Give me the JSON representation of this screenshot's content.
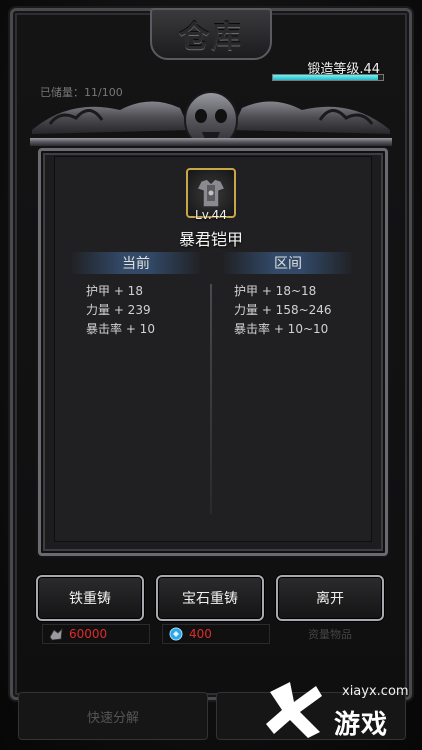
{
  "header": {
    "title": "仓库",
    "forge_level": "锻造等级.44",
    "forge_progress": 0.95,
    "capacity_text": "已储量：11/100"
  },
  "item": {
    "level": "Lv.44",
    "name": "暴君铠甲",
    "icon": "armor-icon",
    "rarity_color": "#c9a64a"
  },
  "columns": {
    "current_label": "当前",
    "range_label": "区间"
  },
  "current_stats": [
    "护甲 + 18",
    "力量 + 239",
    "暴击率 + 10"
  ],
  "range_stats": [
    "护甲 + 18~18",
    "力量 + 158~246",
    "暴击率 + 10~10"
  ],
  "actions": {
    "iron_recast": "铁重铸",
    "gem_recast": "宝石重铸",
    "leave": "离开",
    "under_leave": "资量物品"
  },
  "costs": {
    "iron_amount": "60000",
    "iron_icon": "iron-ore-icon",
    "gem_amount": "400",
    "gem_icon": "gem-icon",
    "cost_color": "#e02a2a"
  },
  "bottom": {
    "quick_decompose": "快速分解"
  },
  "watermark": {
    "url": "xiayx.com",
    "brand": "游戏"
  }
}
